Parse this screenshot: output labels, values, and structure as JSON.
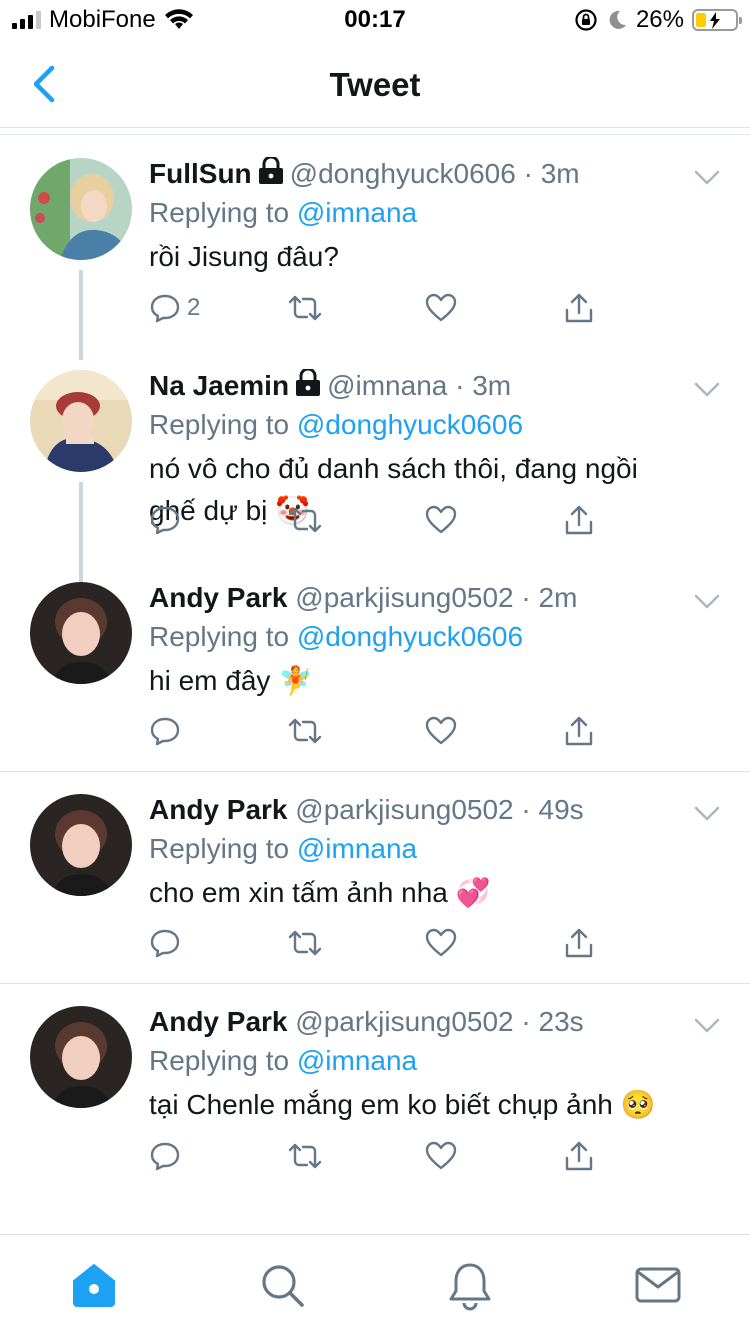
{
  "status_bar": {
    "carrier": "MobiFone",
    "time": "00:17",
    "battery_percent": "26%",
    "battery_level": 0.26,
    "icons": [
      "signal-icon",
      "wifi-icon",
      "orientation-lock-icon",
      "moon-icon",
      "battery-charging-icon"
    ]
  },
  "header": {
    "title": "Tweet",
    "back_icon": "chevron-left-icon"
  },
  "tweets": [
    {
      "name": "FullSun",
      "protected": true,
      "handle": "@donghyuck0606",
      "time": "3m",
      "replying_label": "Replying to",
      "replying_to": "@imnana",
      "text": "rồi Jisung đâu?",
      "reply_count": "2"
    },
    {
      "name": "Na Jaemin",
      "protected": true,
      "handle": "@imnana",
      "time": "3m",
      "replying_label": "Replying to",
      "replying_to": "@donghyuck0606",
      "text": "nó vô cho đủ danh sách thôi, đang ngồi ghế dự bị 🤡",
      "reply_count": ""
    },
    {
      "name": "Andy Park",
      "protected": false,
      "handle": "@parkjisung0502",
      "time": "2m",
      "replying_label": "Replying to",
      "replying_to": "@donghyuck0606",
      "text": "hi em đây 🧚",
      "reply_count": ""
    },
    {
      "name": "Andy Park",
      "protected": false,
      "handle": "@parkjisung0502",
      "time": "49s",
      "replying_label": "Replying to",
      "replying_to": "@imnana",
      "text": "cho em xin tấm ảnh nha 💞",
      "reply_count": ""
    },
    {
      "name": "Andy Park",
      "protected": false,
      "handle": "@parkjisung0502",
      "time": "23s",
      "replying_label": "Replying to",
      "replying_to": "@imnana",
      "text": "tại Chenle mắng em ko biết chụp ảnh 🥺",
      "reply_count": ""
    }
  ],
  "tab_bar": {
    "tabs": [
      "home-icon",
      "search-icon",
      "notifications-icon",
      "messages-icon"
    ],
    "active": "home-icon"
  },
  "colors": {
    "accent": "#1da1f2",
    "text": "#14171a",
    "secondary_text": "#657786",
    "divider": "#dfe3e6"
  }
}
